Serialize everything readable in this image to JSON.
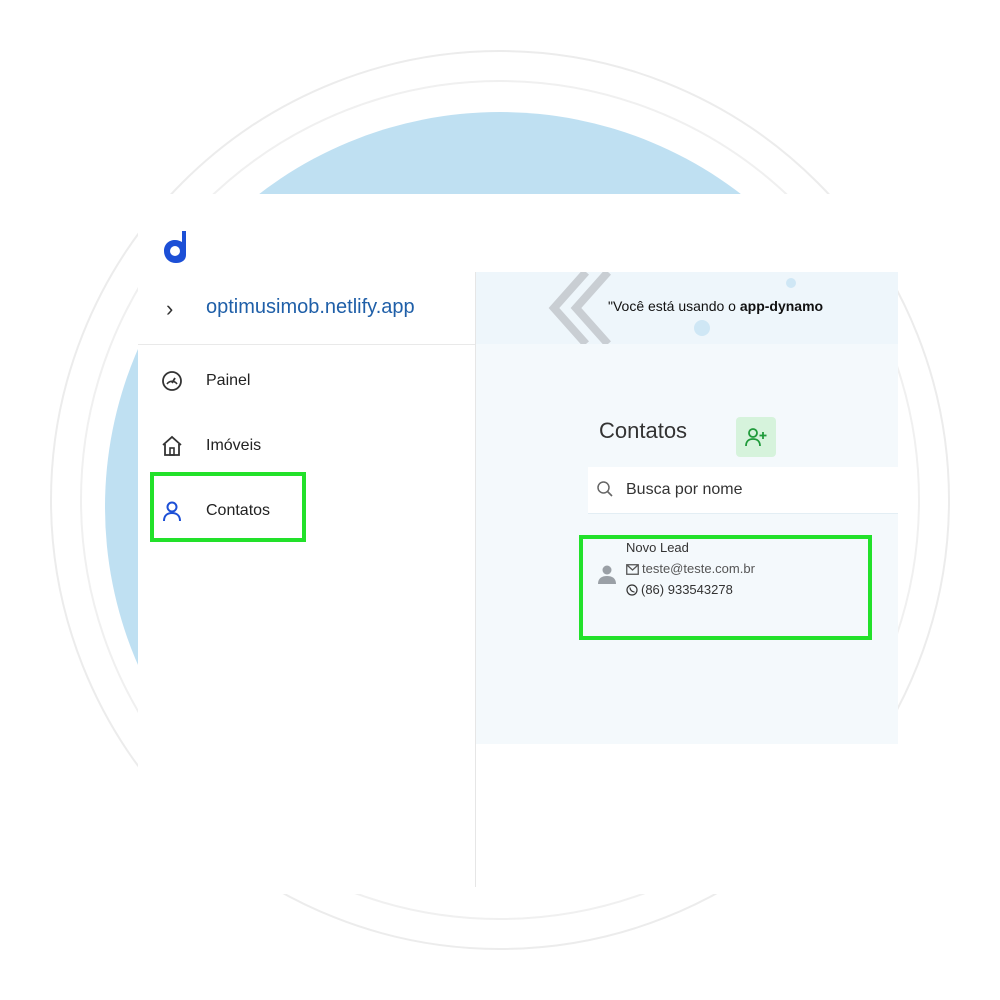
{
  "logo": {
    "name": "dynamo-logo-icon",
    "color": "#1c4fd6"
  },
  "sidebar": {
    "site": {
      "chevron": "›",
      "name": "optimusimob.netlify.app"
    },
    "items": [
      {
        "label": "Painel",
        "icon": "dashboard-icon"
      },
      {
        "label": "Imóveis",
        "icon": "home-icon"
      },
      {
        "label": "Contatos",
        "icon": "user-icon",
        "active": true
      }
    ]
  },
  "banner": {
    "text_prefix": "\"Você está usando o ",
    "text_bold": "app-dynamo"
  },
  "contacts": {
    "title": "Contatos",
    "add_button_icon": "add-user-icon",
    "search": {
      "placeholder": "Busca por nome"
    },
    "list": [
      {
        "name": "Novo Lead",
        "email": "teste@teste.com.br",
        "phone": "(86) 933543278"
      }
    ]
  },
  "colors": {
    "highlight": "#22e12a",
    "link": "#1f5fa8",
    "accent_bg": "#bfe0f2",
    "add_button_bg": "#d6f3dc"
  }
}
